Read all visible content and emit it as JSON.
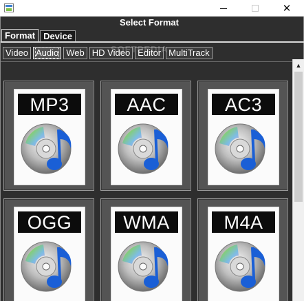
{
  "window": {
    "minimize_glyph": "",
    "maximize_glyph": "",
    "close_glyph": "✕"
  },
  "dialog": {
    "title": "Select Format"
  },
  "main_tabs": [
    {
      "label": "Format",
      "active": true
    },
    {
      "label": "Device",
      "active": false
    }
  ],
  "sub_tabs": [
    {
      "label": "Video",
      "active": false
    },
    {
      "label": "Audio",
      "active": true
    },
    {
      "label": "Web",
      "active": false
    },
    {
      "label": "HD Video",
      "active": false
    },
    {
      "label": "Editor",
      "active": false
    },
    {
      "label": "MultiTrack",
      "active": false
    }
  ],
  "watermark": "SOFTPEDIA",
  "formats": [
    {
      "label": "MP3",
      "icon": "cd-music-note-icon"
    },
    {
      "label": "AAC",
      "icon": "cd-music-note-icon"
    },
    {
      "label": "AC3",
      "icon": "cd-music-note-icon"
    },
    {
      "label": "OGG",
      "icon": "cd-music-note-icon"
    },
    {
      "label": "WMA",
      "icon": "cd-music-note-icon"
    },
    {
      "label": "M4A",
      "icon": "cd-music-note-icon"
    }
  ],
  "colors": {
    "app_background": "#2e2e2e",
    "tile_background": "#545454",
    "label_bar": "#0c0c0c",
    "note_blue": "#1a5fd6"
  }
}
